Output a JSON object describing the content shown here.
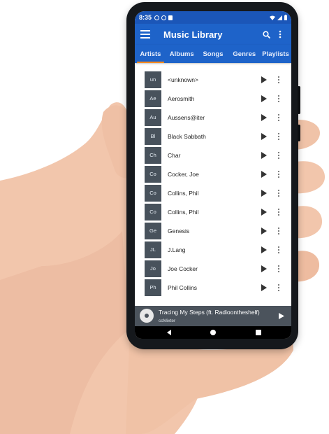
{
  "colors": {
    "primary": "#1e63c9",
    "status_bar": "#1b56b8",
    "tab_indicator": "#ff8a1d",
    "avatar_bg": "#48525c",
    "player_bg": "#4b535c"
  },
  "status": {
    "time": "8:35"
  },
  "app": {
    "title": "Music Library",
    "icons": [
      "menu-icon",
      "search-icon",
      "more-vert-icon"
    ]
  },
  "tabs": [
    {
      "label": "Artists",
      "active": true
    },
    {
      "label": "Albums",
      "active": false
    },
    {
      "label": "Songs",
      "active": false
    },
    {
      "label": "Genres",
      "active": false
    },
    {
      "label": "Playlists",
      "active": false
    }
  ],
  "artists": [
    {
      "abbr": "un",
      "name": "<unknown>"
    },
    {
      "abbr": "Ae",
      "name": "Aerosmith"
    },
    {
      "abbr": "Au",
      "name": "Aussens@iter"
    },
    {
      "abbr": "Bl",
      "name": "Black Sabbath"
    },
    {
      "abbr": "Ch",
      "name": "Char"
    },
    {
      "abbr": "Co",
      "name": "Cocker, Joe"
    },
    {
      "abbr": "Co",
      "name": "Collins, Phil"
    },
    {
      "abbr": "Co",
      "name": "Collins, Phil"
    },
    {
      "abbr": "Ge",
      "name": "Genesis"
    },
    {
      "abbr": "JL",
      "name": "J.Lang"
    },
    {
      "abbr": "Jo",
      "name": "Joe Cocker"
    },
    {
      "abbr": "Ph",
      "name": "Phil Collins"
    }
  ],
  "now_playing": {
    "title": "Tracing My Steps (ft. Radioontheshelf)",
    "artist": "ccMixter"
  }
}
